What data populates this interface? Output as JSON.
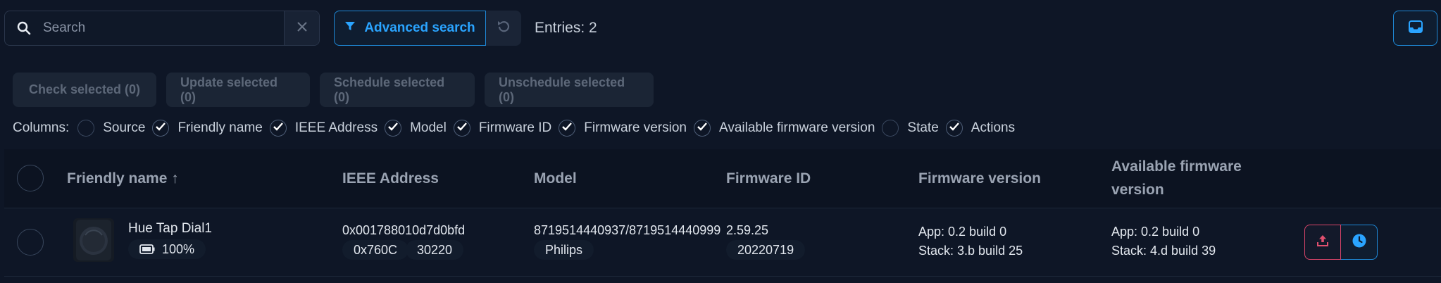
{
  "search": {
    "placeholder": "Search"
  },
  "toolbar": {
    "advanced_search_label": "Advanced search",
    "entries_text": "Entries: 2"
  },
  "actions": {
    "check": "Check selected (0)",
    "update": "Update selected (0)",
    "schedule": "Schedule selected (0)",
    "unschedule": "Unschedule selected (0)"
  },
  "columns": {
    "label": "Columns:",
    "options": [
      {
        "label": "Source",
        "checked": false
      },
      {
        "label": "Friendly name",
        "checked": true
      },
      {
        "label": "IEEE Address",
        "checked": true
      },
      {
        "label": "Model",
        "checked": true
      },
      {
        "label": "Firmware ID",
        "checked": true
      },
      {
        "label": "Firmware version",
        "checked": true
      },
      {
        "label": "Available firmware version",
        "checked": true
      },
      {
        "label": "State",
        "checked": false
      },
      {
        "label": "Actions",
        "checked": true
      }
    ]
  },
  "table": {
    "headers": {
      "friendly_name": "Friendly name ↑",
      "ieee": "IEEE Address",
      "model": "Model",
      "firmware_id": "Firmware ID",
      "firmware_version": "Firmware version",
      "available_line1": "Available firmware",
      "available_line2": "version"
    },
    "rows": [
      {
        "friendly_name": "Hue Tap Dial1",
        "battery": "100%",
        "ieee": "0x001788010d7d0bfd",
        "nwk": "0x760C",
        "lqi": "30220",
        "model": "8719514440937/8719514440999",
        "vendor": "Philips",
        "firmware_id": "2.59.25",
        "firmware_date": "20220719",
        "fw_app": "App: 0.2 build 0",
        "fw_stack": "Stack: 3.b build 25",
        "avail_app": "App: 0.2 build 0",
        "avail_stack": "Stack: 4.d build 39"
      }
    ]
  },
  "colors": {
    "accent": "#1e88d6",
    "danger": "#d9456a",
    "background": "#0e1626"
  }
}
